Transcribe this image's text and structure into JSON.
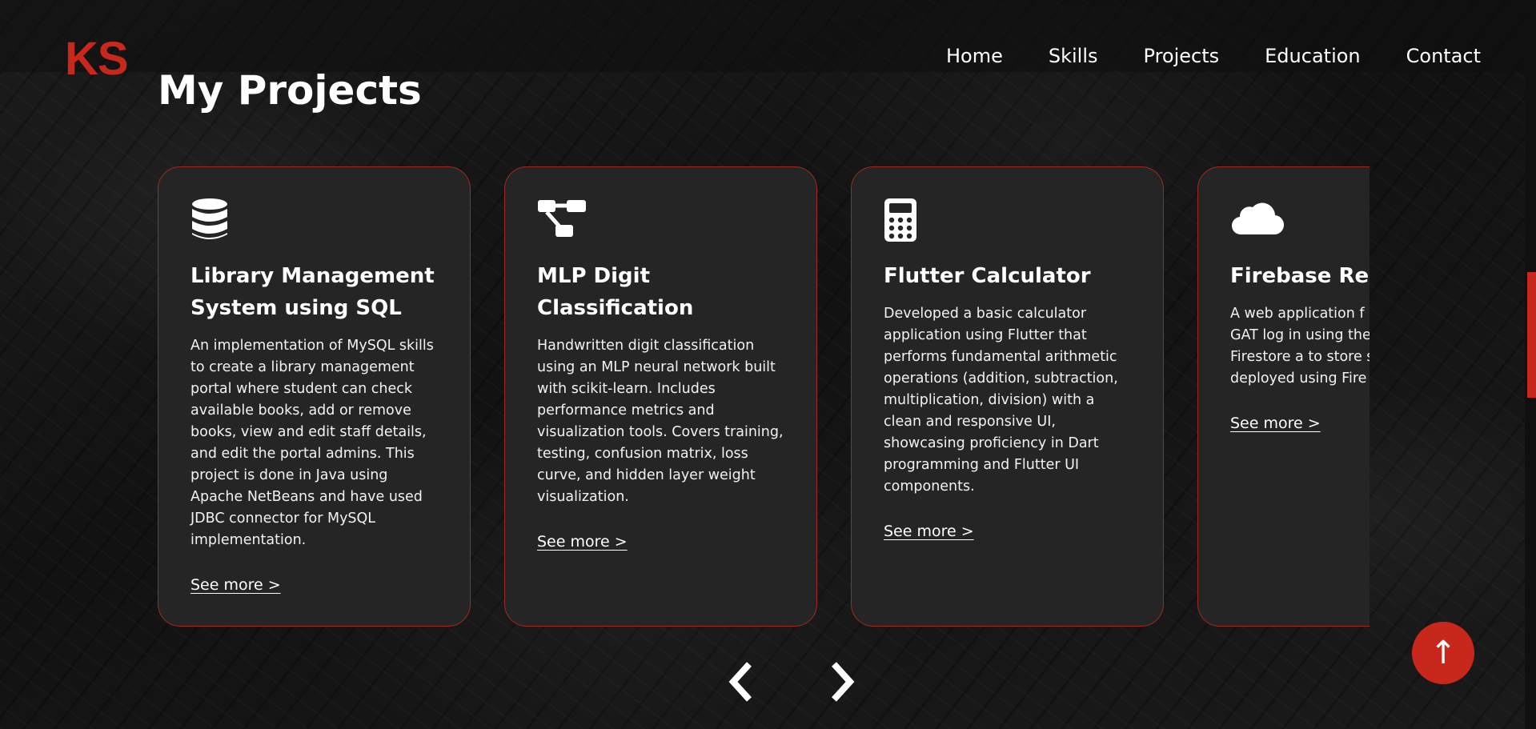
{
  "brand": {
    "logo_text": "KS",
    "accent": "#c8281c"
  },
  "nav": {
    "items": [
      {
        "label": "Home"
      },
      {
        "label": "Skills"
      },
      {
        "label": "Projects"
      },
      {
        "label": "Education"
      },
      {
        "label": "Contact"
      }
    ]
  },
  "section": {
    "title": "My Projects"
  },
  "projects": [
    {
      "icon": "database-icon",
      "title": "Library Management System using SQL",
      "description": "An implementation of MySQL skills to create a library management portal where student can check available books, add or remove books, view and edit staff details, and edit the portal admins. This project is done in Java using Apache NetBeans and have used JDBC connector for MySQL implementation.",
      "link": "See more >"
    },
    {
      "icon": "diagram-project-icon",
      "title": "MLP Digit Classification",
      "description": "Handwritten digit classification using an MLP neural network built with scikit-learn. Includes performance metrics and visualization tools. Covers training, testing, confusion matrix, loss curve, and hidden layer weight visualization.",
      "link": "See more >"
    },
    {
      "icon": "calculator-icon",
      "title": "Flutter Calculator",
      "description": "Developed a basic calculator application using Flutter that performs fundamental arithmetic operations (addition, subtraction, multiplication, division) with a clean and responsive UI, showcasing proficiency in Dart programming and Flutter UI components.",
      "link": "See more >"
    },
    {
      "icon": "cloud-icon",
      "title": "Firebase Regi App",
      "description": "A web application f register for the GAT log in using their cr Firebase Firestore a to store student da deployed using Fire",
      "link": "See more >"
    }
  ],
  "carousel": {
    "prev_icon": "chevron-left-icon",
    "next_icon": "chevron-right-icon"
  },
  "scroll_top": {
    "label": "↑"
  }
}
